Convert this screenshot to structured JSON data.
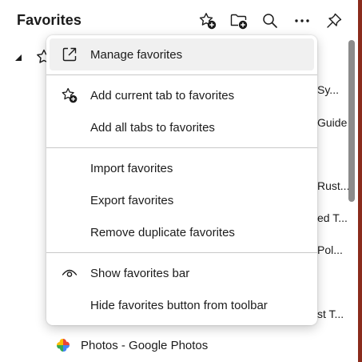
{
  "header": {
    "title": "Favorites",
    "icons": [
      "add-favorite-icon",
      "add-folder-icon",
      "search-icon",
      "more-icon",
      "pin-icon"
    ]
  },
  "background": {
    "fragments": [
      "Sy...",
      "Guide",
      "Rust...",
      "ed T...",
      "Pol...",
      "st T..."
    ],
    "photos_item": "Photos - Google Photos"
  },
  "menu": {
    "items": [
      {
        "label": "Manage favorites",
        "icon": "open-external-icon"
      },
      {
        "label": "Add current tab to favorites",
        "icon": "add-favorite-icon"
      },
      {
        "label": "Add all tabs to favorites",
        "icon": ""
      },
      {
        "label": "Import favorites",
        "icon": ""
      },
      {
        "label": "Export favorites",
        "icon": ""
      },
      {
        "label": "Remove duplicate favorites",
        "icon": ""
      },
      {
        "label": "Show favorites bar",
        "icon": "eye-icon"
      },
      {
        "label": "Hide favorites button from toolbar",
        "icon": ""
      }
    ]
  },
  "colors": {
    "accent_strip": "#8a2b1c",
    "hover": "#f0f0f0"
  }
}
